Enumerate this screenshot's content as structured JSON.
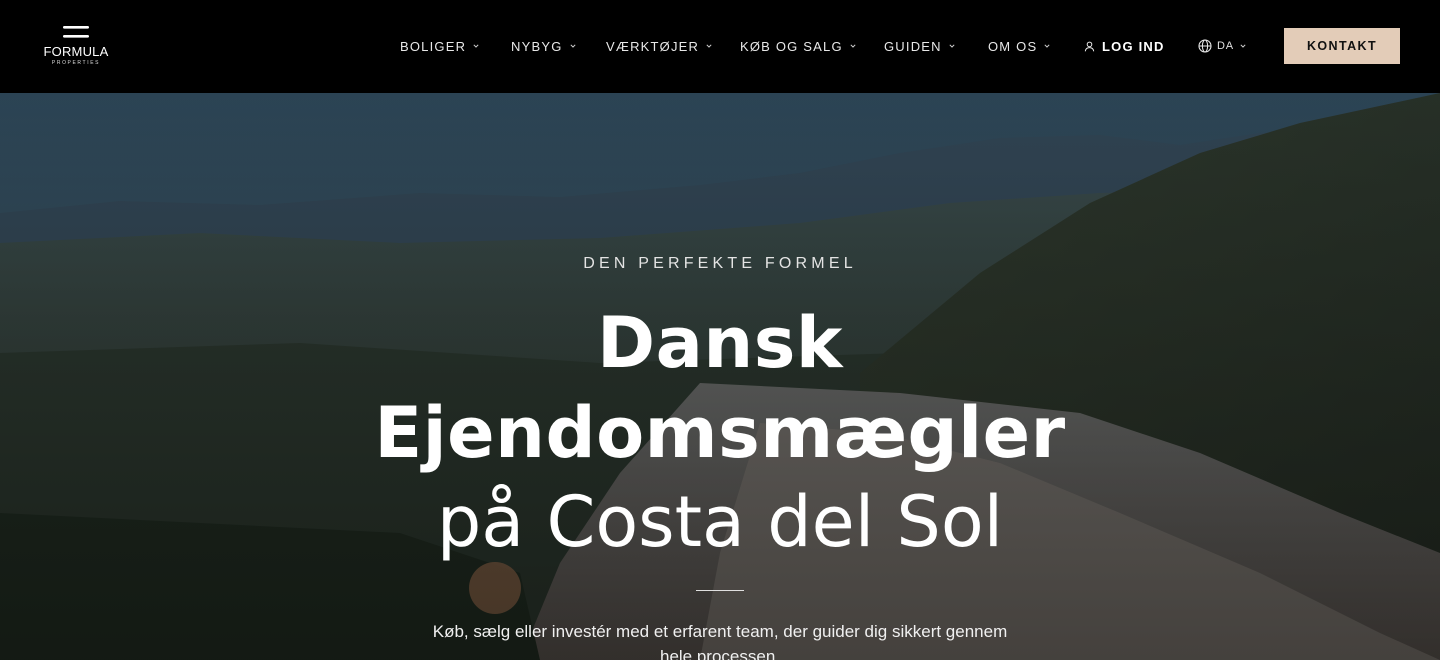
{
  "brand": {
    "name": "FORMULA",
    "tagline": "PROPERTIES"
  },
  "nav": {
    "items": [
      {
        "label": "BOLIGER"
      },
      {
        "label": "NYBYG"
      },
      {
        "label": "VÆRKTØJER"
      },
      {
        "label": "KØB OG SALG"
      },
      {
        "label": "GUIDEN"
      },
      {
        "label": "OM OS"
      }
    ],
    "login_label": "LOG IND",
    "language": "DA",
    "contact_label": "KONTAKT"
  },
  "hero": {
    "eyebrow": "DEN PERFEKTE FORMEL",
    "title_line1": "Dansk",
    "title_line2": "Ejendomsmægler",
    "title_line3": "på Costa del Sol",
    "lead": "Køb, sælg eller investér med et erfarent team, der guider dig sikkert gennem hele processen."
  },
  "colors": {
    "header_bg": "#000000",
    "accent_button": "#e3ccb8",
    "text_light": "#ffffff"
  }
}
